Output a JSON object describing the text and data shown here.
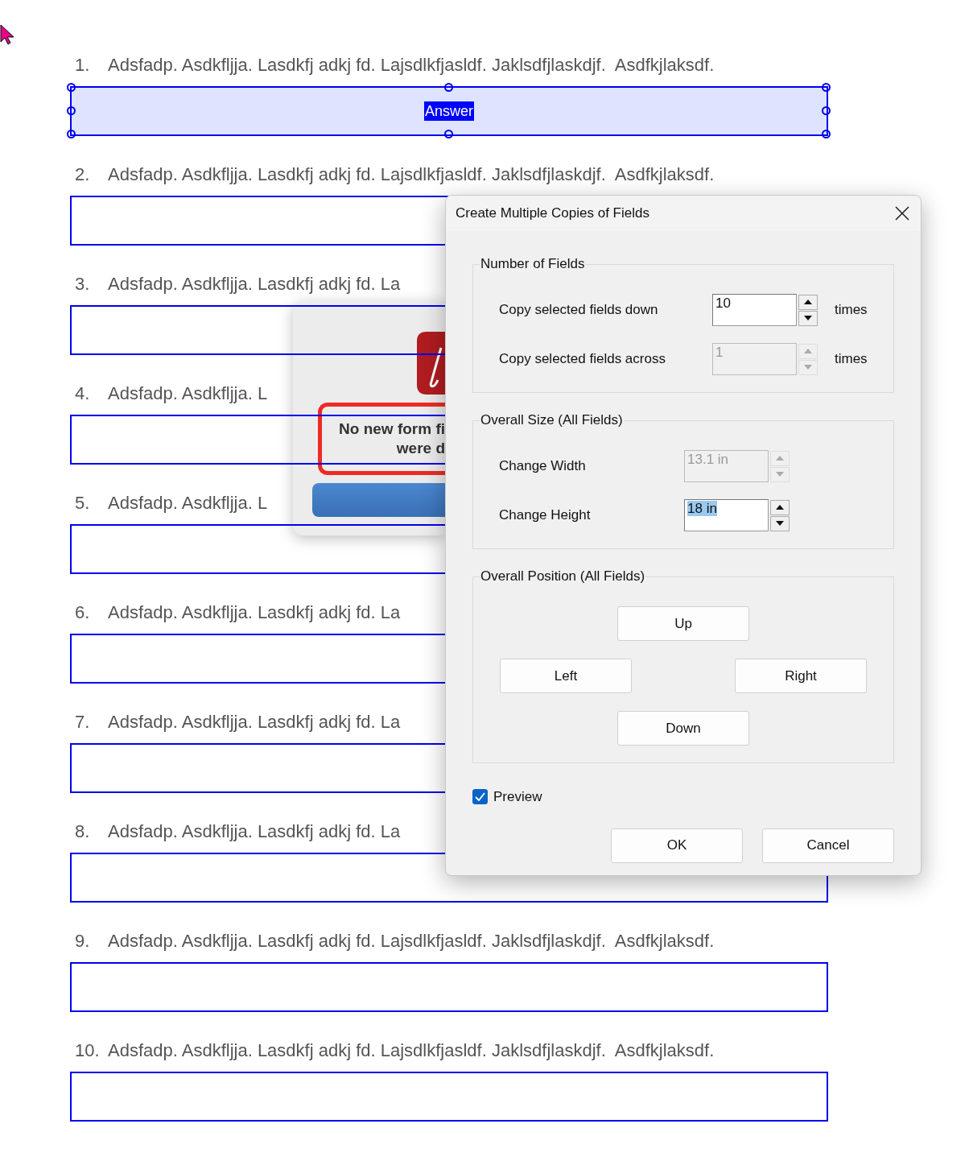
{
  "questions": [
    {
      "number": "1.",
      "text": "Adsfadp. Asdkfljja. Lasdkfj adkj fd. Lajsdlkfjasldf. Jaklsdfjlaskdjf.  Asdfkjlaksdf.",
      "field": {
        "selected": true,
        "label": "Answer"
      }
    },
    {
      "number": "2.",
      "text": "Adsfadp. Asdkfljja. Lasdkfj adkj fd. Lajsdlkfjasldf. Jaklsdfjlaskdjf.  Asdfkjlaksdf.",
      "field": {
        "selected": false
      }
    },
    {
      "number": "3.",
      "text": "Adsfadp. Asdkfljja. Lasdkfj adkj fd. La",
      "field": {
        "selected": false
      }
    },
    {
      "number": "4.",
      "text": "Adsfadp. Asdkfljja. L",
      "field": {
        "selected": false
      }
    },
    {
      "number": "5.",
      "text": "Adsfadp. Asdkfljja. L",
      "field": {
        "selected": false
      }
    },
    {
      "number": "6.",
      "text": "Adsfadp. Asdkfljja. Lasdkfj adkj fd. La",
      "field": {
        "selected": false
      }
    },
    {
      "number": "7.",
      "text": "Adsfadp. Asdkfljja. Lasdkfj adkj fd. La",
      "field": {
        "selected": false
      }
    },
    {
      "number": "8.",
      "text": "Adsfadp. Asdkfljja. Lasdkfj adkj fd. La",
      "field": {
        "selected": false
      }
    },
    {
      "number": "9.",
      "text": "Adsfadp. Asdkfljja. Lasdkfj adkj fd. Lajsdlkfjasldf. Jaklsdfjlaskdjf.  Asdfkjlaksdf.",
      "field": {
        "selected": false
      }
    },
    {
      "number": "10.",
      "text": "Adsfadp. Asdkfljja. Lasdkfj adkj fd. Lajsdlkfjasldf. Jaklsdfjlaskdjf.  Asdfkjlaksdf.",
      "field": {
        "selected": false
      }
    }
  ],
  "alert": {
    "lines": [
      "No new form fi",
      "were d"
    ]
  },
  "dialog": {
    "title": "Create Multiple Copies of Fields",
    "number_of_fields": {
      "title": "Number of Fields",
      "rows": [
        {
          "label": "Copy selected fields down",
          "value": "10",
          "unit": "times",
          "disabled": false,
          "text_selected": false
        },
        {
          "label": "Copy selected fields across",
          "value": "1",
          "unit": "times",
          "disabled": true,
          "text_selected": false
        }
      ]
    },
    "overall_size": {
      "title": "Overall Size (All Fields)",
      "rows": [
        {
          "label": "Change Width",
          "value": "13.1 in",
          "disabled": true,
          "text_selected": false
        },
        {
          "label": "Change Height",
          "value": "18 in",
          "disabled": false,
          "text_selected": true
        }
      ]
    },
    "overall_position": {
      "title": "Overall Position (All Fields)",
      "buttons": {
        "up": "Up",
        "left": "Left",
        "right": "Right",
        "down": "Down"
      }
    },
    "preview": {
      "label": "Preview",
      "checked": true
    },
    "buttons": [
      "OK",
      "Cancel"
    ]
  }
}
